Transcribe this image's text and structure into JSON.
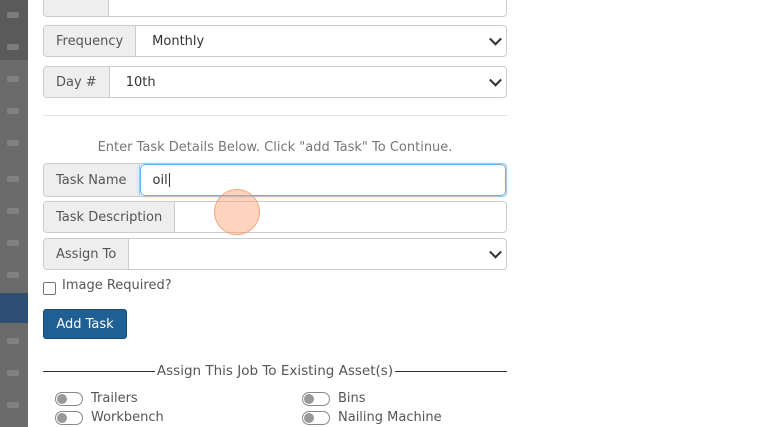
{
  "form": {
    "frequency": {
      "label": "Frequency",
      "value": "Monthly"
    },
    "day_number": {
      "label": "Day #",
      "value": "10th"
    },
    "hint": "Enter Task Details Below. Click \"add Task\" To Continue.",
    "task_name": {
      "label": "Task Name",
      "value": "oil"
    },
    "task_description": {
      "label": "Task Description",
      "value": ""
    },
    "assign_to": {
      "label": "Assign To",
      "value": ""
    },
    "image_required_label": "Image Required?",
    "add_task_label": "Add Task"
  },
  "assets": {
    "heading": "Assign This Job To Existing Asset(s)",
    "items": [
      {
        "label": "Trailers"
      },
      {
        "label": "Bins"
      },
      {
        "label": "Workbench"
      },
      {
        "label": "Nailing Machine"
      }
    ]
  },
  "colors": {
    "primary_button": "#1f5f94",
    "sidebar_selected": "#2d4f73",
    "focus_ring": "#66afe9"
  }
}
